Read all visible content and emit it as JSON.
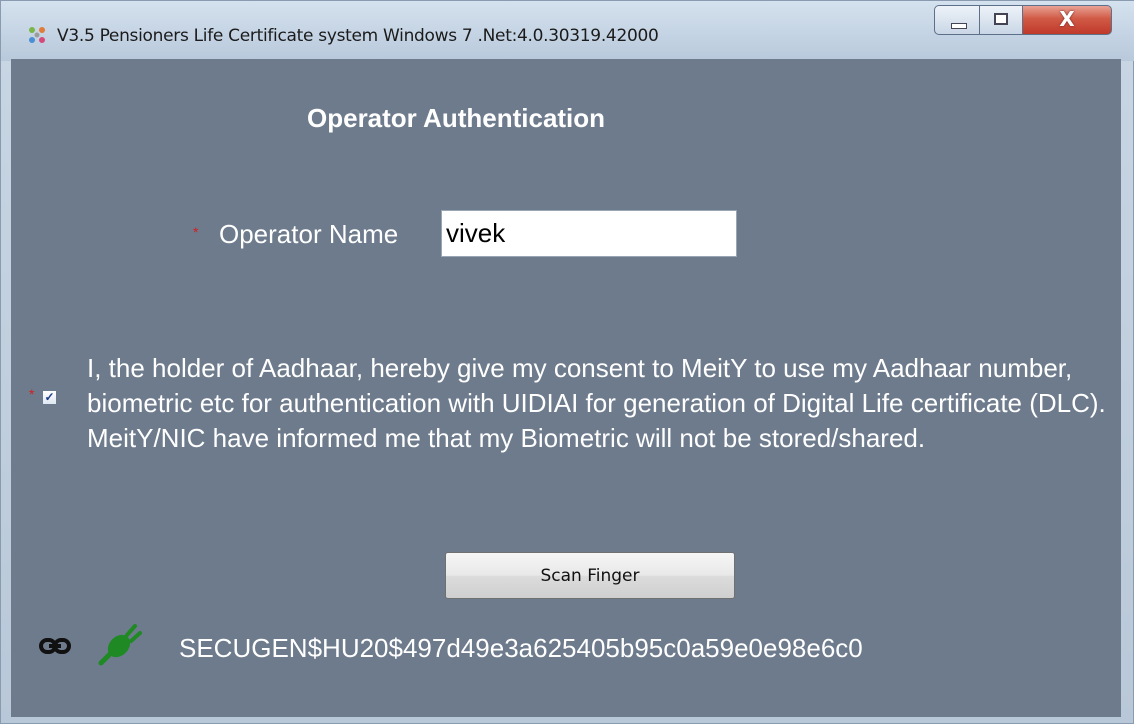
{
  "window": {
    "title": "V3.5 Pensioners Life Certificate system Windows 7 .Net:4.0.30319.42000",
    "close_glyph": "X"
  },
  "form": {
    "heading": "Operator Authentication",
    "required_mark": "*",
    "operator_label": "Operator Name",
    "operator_value": "vivek",
    "consent_checked": true,
    "consent_check_glyph": "✓",
    "consent_text": "I, the holder of Aadhaar, hereby give my consent to MeitY to use my Aadhaar number, biometric etc for authentication with UIDIAI for generation of Digital Life certificate (DLC). MeitY/NIC have informed me that my Biometric will not be stored/shared.",
    "scan_button": "Scan Finger"
  },
  "status": {
    "device_id": "SECUGEN$HU20$497d49e3a625405b95c0a59e0e98e6c0",
    "link_icon": "link-icon",
    "device_icon": "plug-connected-icon",
    "device_color": "#1f8a24"
  }
}
